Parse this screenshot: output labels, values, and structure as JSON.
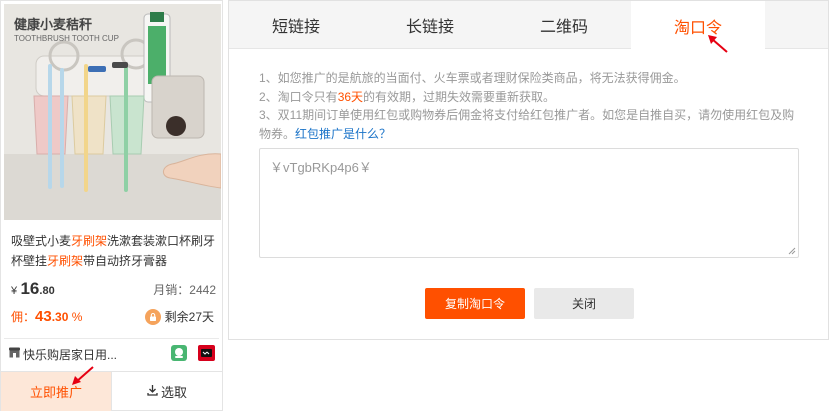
{
  "product": {
    "image": {
      "brand_text": "健康小麦秸秆",
      "sub_text": "TOOTHBRUSH TOOTH CUP"
    },
    "title_segments": [
      {
        "text": "吸壁式小麦",
        "highlight": false
      },
      {
        "text": "牙刷架",
        "highlight": true
      },
      {
        "text": "洗漱套装漱口杯刷牙杯壁挂",
        "highlight": false
      },
      {
        "text": "牙刷架",
        "highlight": true
      },
      {
        "text": "带自动挤牙膏器",
        "highlight": false
      }
    ],
    "price": {
      "symbol": "¥",
      "integer": "16",
      "decimal": ".80"
    },
    "sales": "月销：2442",
    "commission": {
      "label": "佣：",
      "integer": "43",
      "decimal": ".30",
      "unit": "%"
    },
    "days_left": "剩余27天",
    "shop_name": "快乐购居家日用...",
    "promote_label": "立即推广",
    "select_label": "选取"
  },
  "dialog": {
    "tabs": [
      {
        "label": "短链接",
        "active": false
      },
      {
        "label": "长链接",
        "active": false
      },
      {
        "label": "二维码",
        "active": false
      },
      {
        "label": "淘口令",
        "active": true
      }
    ],
    "note1": "1、如您推广的是航旅的当面付、火车票或者理财保险类商品，将无法获得佣金。",
    "note2": {
      "before": "2、淘口令只有",
      "highlight": "36天",
      "after": "的有效期，过期失效需要重新获取。"
    },
    "note3": {
      "text": "3、双11期间订单使用红包或购物券后佣金将支付给红包推广者。如您是自推自买，请勿使用红包及购物券。",
      "link": "红包推广是什么？"
    },
    "token": "￥vTgbRKp4p6￥",
    "copy_button": "复制淘口令",
    "close_button": "关闭"
  },
  "colors": {
    "accent": "#ff5000",
    "link": "#1a73c8",
    "arrow": "#e60012"
  }
}
